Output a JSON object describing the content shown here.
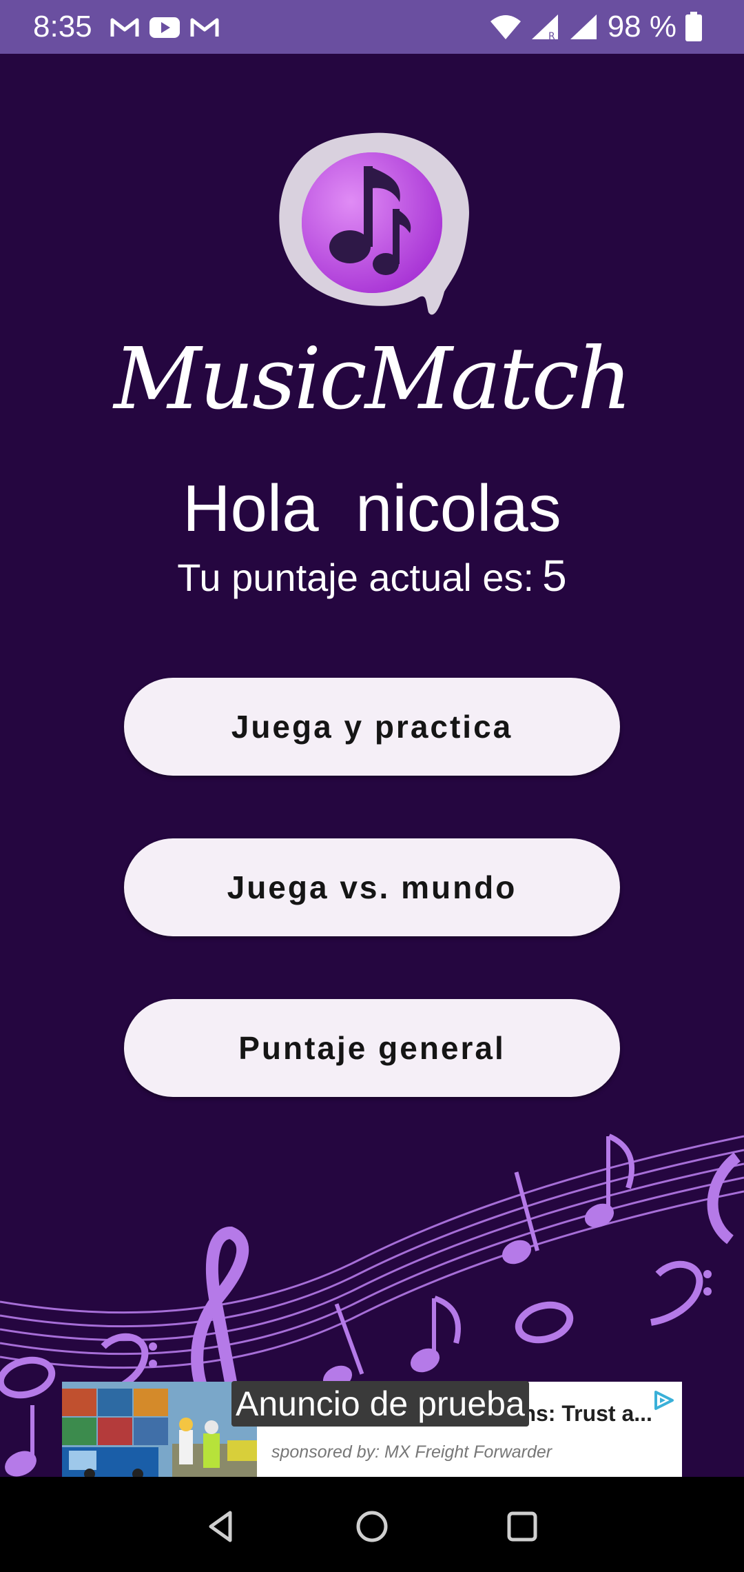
{
  "status_bar": {
    "time": "8:35",
    "notifications": [
      "gmail-icon",
      "youtube-icon",
      "gmail-icon"
    ],
    "battery": "98 %"
  },
  "app": {
    "name": "MusicMatch",
    "greeting": "Hola  nicolas",
    "score_label": "Tu puntaje actual es:",
    "score_value": "5"
  },
  "buttons": {
    "practice": "Juega y practica",
    "versus": "Juega vs. mundo",
    "leaderboard": "Puntaje general"
  },
  "ad": {
    "test_label": "Anuncio de prueba",
    "headline": "ions: Trust a...",
    "sponsor": "sponsored by: MX Freight Forwarder"
  },
  "colors": {
    "background": "#250640",
    "status_bar": "#6a4fa0",
    "button": "#f5eff7",
    "accent": "#b57ae8"
  }
}
